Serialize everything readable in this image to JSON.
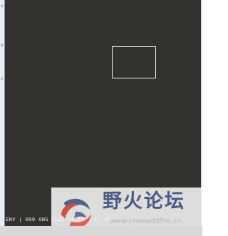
{
  "window": {
    "left_markers": [
      "›",
      "›",
      "›"
    ],
    "status_text": "ENV | 000  ANG PLOT  PR YTZH  PY EX"
  },
  "viewport": {
    "background_color": "#33322e",
    "selection_color": "#f2f2f2"
  },
  "watermark": {
    "title": "野火论坛",
    "url": "www.proewildfire.cn",
    "logo_icon": "wildfire-swirl-logo"
  }
}
